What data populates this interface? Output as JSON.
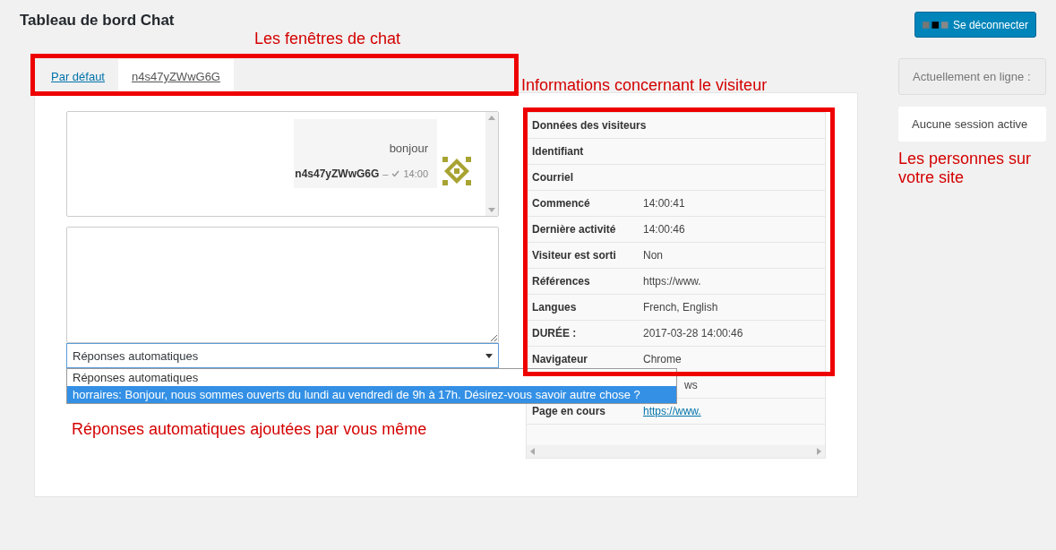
{
  "page": {
    "title": "Tableau de bord Chat"
  },
  "logout_button": {
    "label": "Se déconnecter"
  },
  "tabs": [
    {
      "label": "Par défaut",
      "selected": false
    },
    {
      "label": "n4s47yZWwG6G",
      "selected": true
    }
  ],
  "chat": {
    "messages": [
      {
        "text": "bonjour",
        "author": "n4s47yZWwG6G",
        "separator": "–",
        "time": "14:00"
      }
    ]
  },
  "auto_reply_select": {
    "value": "Réponses automatiques",
    "options": [
      {
        "label": "Réponses automatiques",
        "highlighted": false
      },
      {
        "label": "horraires: Bonjour, nous sommes ouverts du lundi au vendredi de 9h à 17h. Désirez-vous savoir autre chose ?",
        "highlighted": true
      }
    ]
  },
  "visitor_table": {
    "rows": [
      {
        "kind": "text",
        "label": "Données des visiteurs"
      },
      {
        "kind": "text",
        "label": "Identifiant"
      },
      {
        "kind": "text",
        "label": "Courriel"
      },
      {
        "kind": "text",
        "label": "Commencé",
        "value": "14:00:41"
      },
      {
        "kind": "text",
        "label": "Dernière activité",
        "value": "14:00:46"
      },
      {
        "kind": "text",
        "label": "Visiteur est sorti",
        "value": "Non"
      },
      {
        "kind": "text",
        "label": "Références",
        "value": "https://www."
      },
      {
        "kind": "text",
        "label": "Langues",
        "value": "French, English"
      },
      {
        "kind": "text",
        "label": "DURÉE :",
        "value": "2017-03-28 14:00:46"
      },
      {
        "kind": "text",
        "label": "Navigateur",
        "value": "Chrome"
      },
      {
        "kind": "covered",
        "value": "ws"
      },
      {
        "kind": "link",
        "label": "Page en cours",
        "value": "https://www."
      }
    ]
  },
  "sidebar": {
    "online_label": "Actuellement en ligne :",
    "sessions": "Aucune session active"
  },
  "annotations": [
    {
      "text": "Les fenêtres de chat"
    },
    {
      "text": "Informations concernant le visiteur"
    },
    {
      "text": "Réponses automatiques ajoutées par vous même"
    },
    {
      "text": "Les personnes sur votre site"
    }
  ]
}
